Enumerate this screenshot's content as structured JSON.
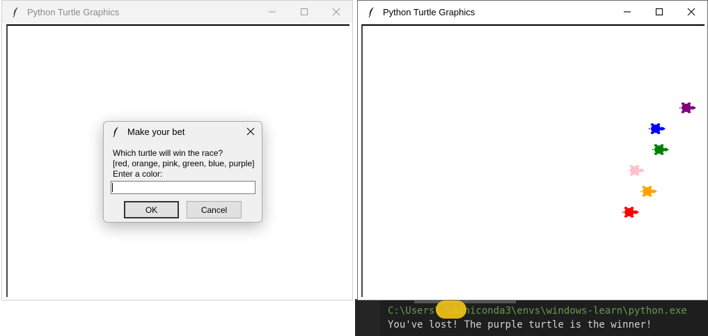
{
  "left_window": {
    "title": "Python Turtle Graphics",
    "state": "inactive"
  },
  "right_window": {
    "title": "Python Turtle Graphics",
    "state": "active"
  },
  "dialog": {
    "title": "Make your bet",
    "prompt_lines": [
      "Which turtle will win the race?",
      "[red, orange, pink, green, blue, purple]",
      "Enter a color:"
    ],
    "input_value": "",
    "ok_label": "OK",
    "cancel_label": "Cancel"
  },
  "turtles": [
    {
      "color_name": "purple",
      "color": "#800080"
    },
    {
      "color_name": "blue",
      "color": "#0000ff"
    },
    {
      "color_name": "green",
      "color": "#008000"
    },
    {
      "color_name": "pink",
      "color": "#ffc0cb"
    },
    {
      "color_name": "orange",
      "color": "#ffa500"
    },
    {
      "color_name": "red",
      "color": "#ff0000"
    }
  ],
  "terminal": {
    "path_line": "C:\\Users\\    \\miniconda3\\envs\\windows-learn\\python.exe",
    "output_line": "You've lost! The purple turtle is the winner!"
  }
}
